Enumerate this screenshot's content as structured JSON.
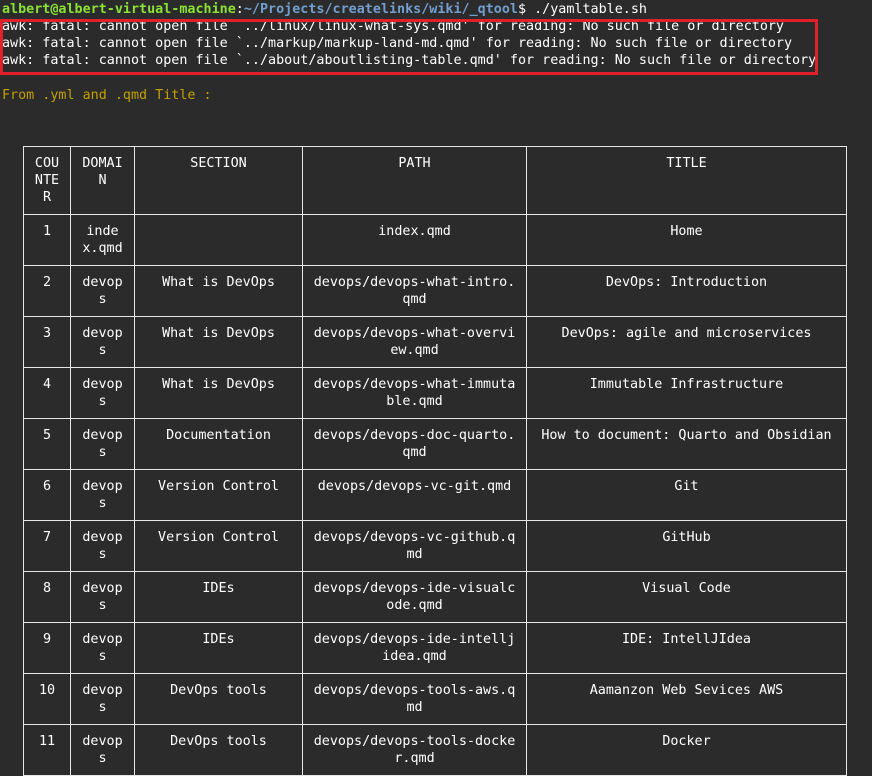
{
  "prompt": {
    "user_host": "albert@albert-virtual-machine",
    "separator": ":",
    "path": "~/Projects/createlinks/wiki/_qtool",
    "symbol": "$",
    "command": " ./yamltable.sh"
  },
  "errors": [
    "awk: fatal: cannot open file `../linux/linux-what-sys.qmd' for reading: No such file or directory",
    "awk: fatal: cannot open file `../markup/markup-land-md.qmd' for reading: No such file or directory",
    "awk: fatal: cannot open file `../about/aboutlisting-table.qmd' for reading: No such file or directory"
  ],
  "info_line": "From .yml and .qmd Title :",
  "table": {
    "headers": [
      "COUNTER",
      "DOMAIN",
      "SECTION",
      "PATH",
      "TITLE"
    ],
    "rows": [
      [
        "1",
        "index.qmd",
        "",
        "index.qmd",
        "Home"
      ],
      [
        "2",
        "devops",
        "What is DevOps",
        "devops/devops-what-intro.qmd",
        "DevOps: Introduction"
      ],
      [
        "3",
        "devops",
        "What is DevOps",
        "devops/devops-what-overview.qmd",
        "DevOps: agile and microservices"
      ],
      [
        "4",
        "devops",
        "What is DevOps",
        "devops/devops-what-immutable.qmd",
        "Immutable Infrastructure"
      ],
      [
        "5",
        "devops",
        "Documentation",
        "devops/devops-doc-quarto.qmd",
        "How to document: Quarto and Obsidian"
      ],
      [
        "6",
        "devops",
        "Version Control",
        "devops/devops-vc-git.qmd",
        "Git"
      ],
      [
        "7",
        "devops",
        "Version Control",
        "devops/devops-vc-github.qmd",
        "GitHub"
      ],
      [
        "8",
        "devops",
        "IDEs",
        "devops/devops-ide-visualcode.qmd",
        "Visual Code"
      ],
      [
        "9",
        "devops",
        "IDEs",
        "devops/devops-ide-intelljidea.qmd",
        "IDE: IntellJIdea"
      ],
      [
        "10",
        "devops",
        "DevOps tools",
        "devops/devops-tools-aws.qmd",
        "Aamanzon Web Sevices AWS"
      ],
      [
        "11",
        "devops",
        "DevOps tools",
        "devops/devops-tools-docker.qmd",
        "Docker"
      ]
    ]
  },
  "colors": {
    "background": "#2b2b2b",
    "prompt_user": "#8ae234",
    "prompt_path": "#729fcf",
    "info_text": "#c4a000",
    "highlight_box": "#e0202a",
    "table_border": "#e6e6e6"
  }
}
